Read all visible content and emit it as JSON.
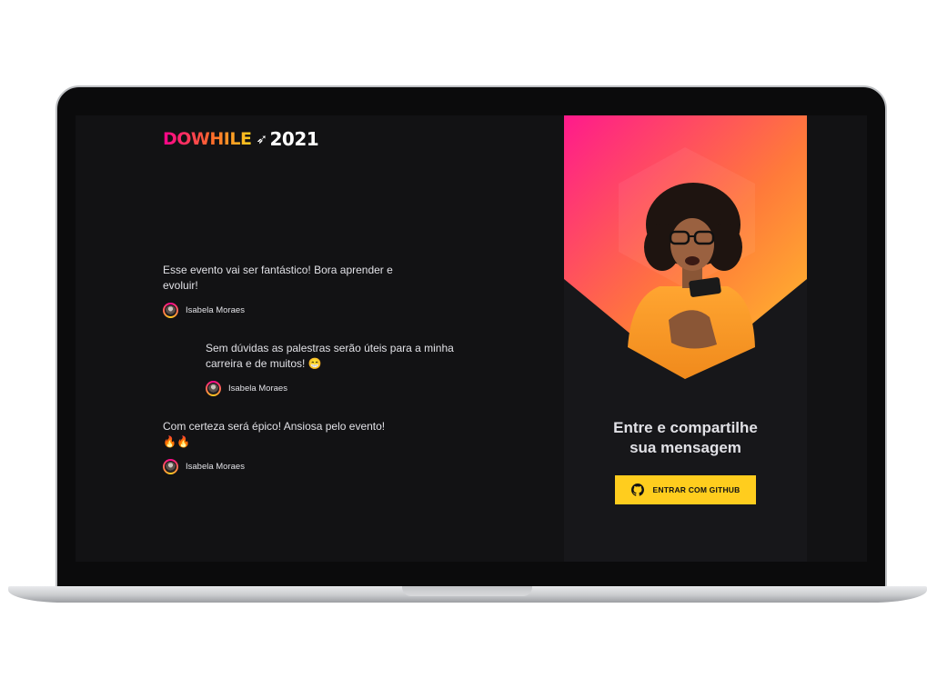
{
  "logo": {
    "brand": "DOWHILE",
    "year": "2021"
  },
  "messages": [
    {
      "text": "Esse evento vai ser fantástico! Bora aprender e evoluir!",
      "author": "Isabela Moraes"
    },
    {
      "text": "Sem dúvidas as palestras serão úteis para a minha carreira e de muitos! 😁",
      "author": "Isabela Moraes"
    },
    {
      "text": "Com certeza será épico! Ansiosa pelo evento! 🔥🔥",
      "author": "Isabela Moraes"
    }
  ],
  "login": {
    "title_line1": "Entre e compartilhe",
    "title_line2": "sua mensagem",
    "button_label": "ENTRAR COM GITHUB",
    "button_icon": "github-icon"
  },
  "colors": {
    "background": "#121214",
    "panel": "#17171a",
    "accent_yellow": "#ffcd1e",
    "accent_pink": "#ff008e",
    "accent_orange": "#ff6a2b",
    "text": "#e1e1e6"
  }
}
